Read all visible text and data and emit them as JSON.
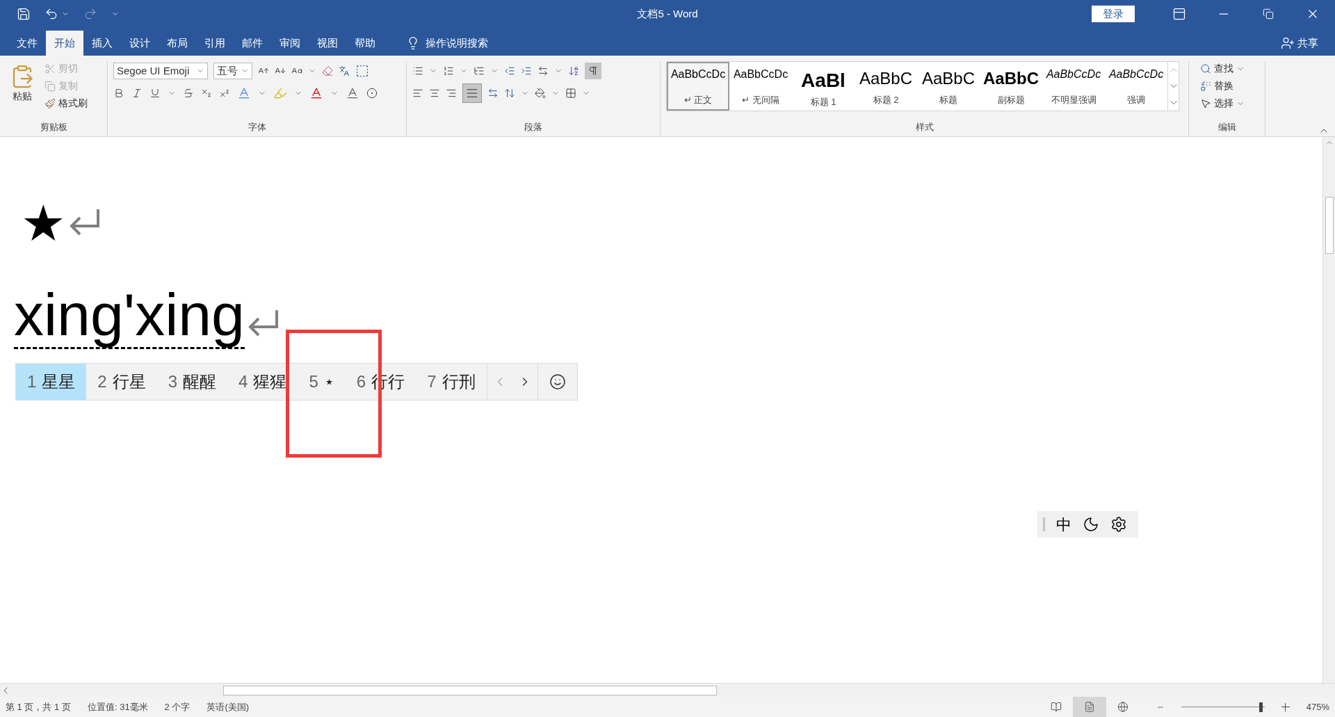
{
  "window": {
    "title": "文档5 - Word",
    "login": "登录"
  },
  "tabs": [
    {
      "label": "文件",
      "selected": false
    },
    {
      "label": "开始",
      "selected": true
    },
    {
      "label": "插入",
      "selected": false
    },
    {
      "label": "设计",
      "selected": false
    },
    {
      "label": "布局",
      "selected": false
    },
    {
      "label": "引用",
      "selected": false
    },
    {
      "label": "邮件",
      "selected": false
    },
    {
      "label": "审阅",
      "selected": false
    },
    {
      "label": "视图",
      "selected": false
    },
    {
      "label": "帮助",
      "selected": false
    }
  ],
  "tell_me": "操作说明搜索",
  "share": "共享",
  "clipboard": {
    "label": "剪贴板",
    "paste": "粘贴",
    "cut": {
      "label": "剪切",
      "disabled": true
    },
    "copy": {
      "label": "复制",
      "disabled": true
    },
    "format_painter": "格式刷"
  },
  "font": {
    "label": "字体",
    "name": "Segoe UI Emoji",
    "size": "五号"
  },
  "paragraph": {
    "label": "段落"
  },
  "styles": {
    "label": "样式",
    "items": [
      {
        "preview": "AaBbCcDc",
        "label": "↵ 正文",
        "kind": "normal",
        "selected": true
      },
      {
        "preview": "AaBbCcDc",
        "label": "↵ 无间隔",
        "kind": "normal",
        "selected": false
      },
      {
        "preview": "AaBl",
        "label": "标题 1",
        "kind": "heading1",
        "selected": false
      },
      {
        "preview": "AaBbC",
        "label": "标题 2",
        "kind": "heading",
        "selected": false
      },
      {
        "preview": "AaBbC",
        "label": "标题",
        "kind": "heading",
        "selected": false
      },
      {
        "preview": "AaBbC",
        "label": "副标题",
        "kind": "bold",
        "selected": false
      },
      {
        "preview": "AaBbCcDc",
        "label": "不明显强调",
        "kind": "italic",
        "selected": false
      },
      {
        "preview": "AaBbCcDc",
        "label": "强调",
        "kind": "italic",
        "selected": false
      }
    ]
  },
  "editing": {
    "label": "编辑",
    "find": "查找",
    "replace": "替换",
    "select": "选择"
  },
  "document": {
    "paragraphs": [
      {
        "kind": "symbol",
        "text": "★"
      },
      {
        "kind": "composing",
        "text": "xing'xing"
      }
    ]
  },
  "candidates": [
    {
      "index": "1",
      "text": "星星",
      "selected": true
    },
    {
      "index": "2",
      "text": "行星",
      "selected": false
    },
    {
      "index": "3",
      "text": "醒醒",
      "selected": false
    },
    {
      "index": "4",
      "text": "猩猩",
      "selected": false
    },
    {
      "index": "5",
      "text": "⋆",
      "selected": false
    },
    {
      "index": "6",
      "text": "行行",
      "selected": false
    },
    {
      "index": "7",
      "text": "行刑",
      "selected": false
    }
  ],
  "ime_bar": {
    "mode": "中"
  },
  "status_bar": {
    "items": [
      "第 1 页，共 1 页",
      "位置值: 31毫米",
      "2 个字",
      "英语(美国)"
    ],
    "views": [
      {
        "selected": false
      },
      {
        "selected": true
      },
      {
        "selected": false
      }
    ],
    "zoom": {
      "level": 0.95,
      "reading": "475%"
    }
  }
}
